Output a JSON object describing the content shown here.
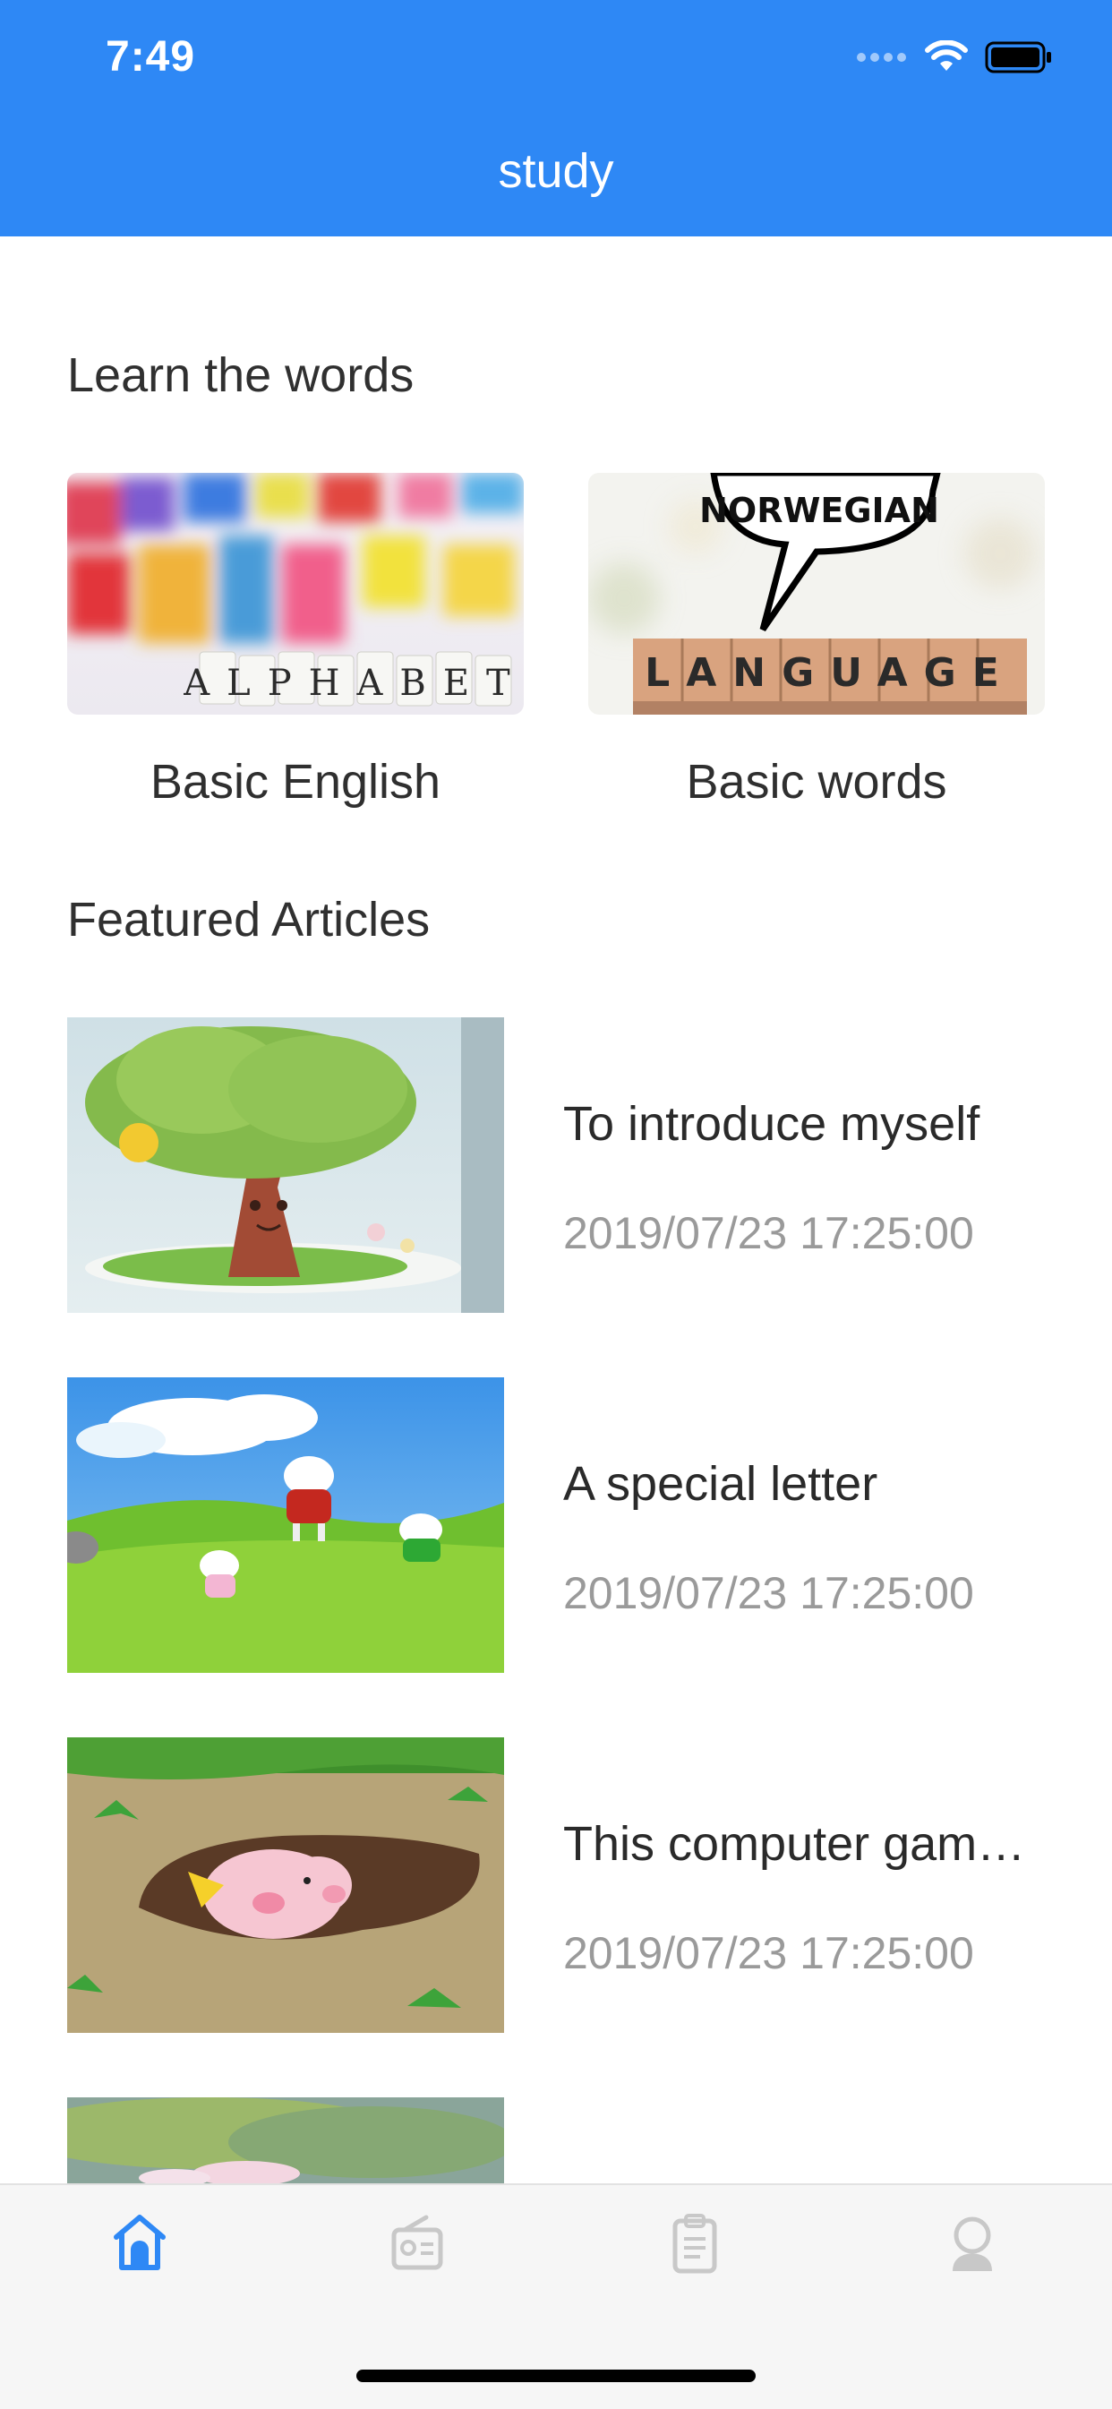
{
  "status_bar": {
    "time": "7:49"
  },
  "nav": {
    "title": "study"
  },
  "learn_section": {
    "title": "Learn the words",
    "cards": [
      {
        "label": "Basic English",
        "image_text": "ALPHABET"
      },
      {
        "label": "Basic words",
        "image_text": "LANGUAGE",
        "bubble_text": "NORWEGIAN"
      }
    ]
  },
  "featured_section": {
    "title": "Featured Articles",
    "articles": [
      {
        "title": "To introduce myself",
        "date": "2019/07/23 17:25:00"
      },
      {
        "title": "A special letter",
        "date": "2019/07/23 17:25:00"
      },
      {
        "title": "This computer game is so fun",
        "date": "2019/07/23 17:25:00"
      }
    ]
  },
  "tabbar": {
    "tabs": [
      {
        "icon": "home-icon",
        "active": true
      },
      {
        "icon": "radio-icon",
        "active": false
      },
      {
        "icon": "clipboard-icon",
        "active": false
      },
      {
        "icon": "user-icon",
        "active": false
      }
    ]
  },
  "colors": {
    "accent": "#2e88f5",
    "inactive_icon": "#c8c8c8"
  }
}
